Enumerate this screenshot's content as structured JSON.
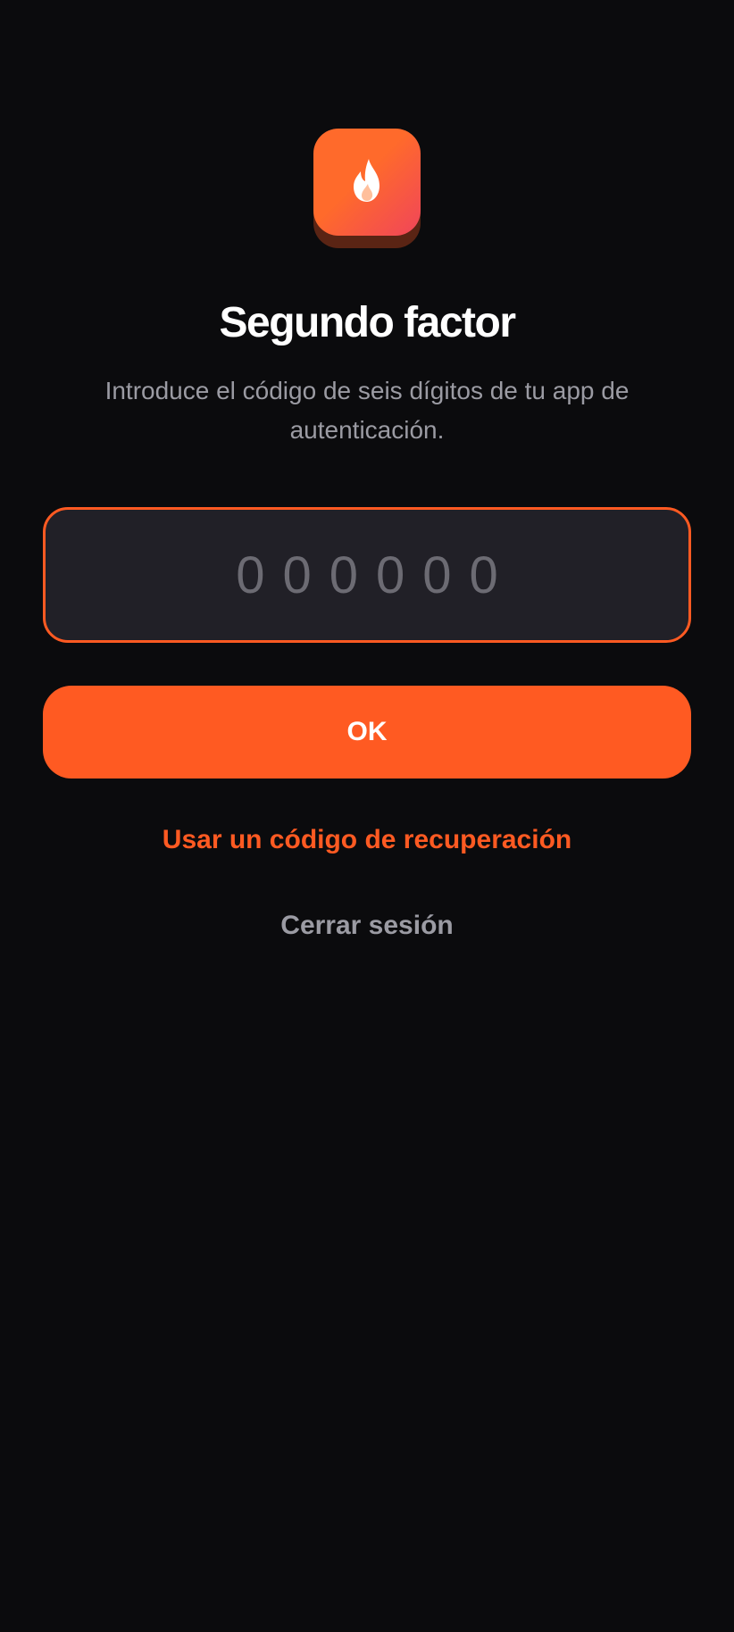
{
  "screen": {
    "title": "Segundo factor",
    "subtitle": "Introduce el código de seis dígitos de tu app de autenticación."
  },
  "app_icon": {
    "icon": "flame-icon",
    "gradient_start": "#ff6a2b",
    "gradient_end": "#f0455a"
  },
  "code_field": {
    "value": "",
    "placeholder": "000000",
    "border_color": "#ff5a22"
  },
  "actions": {
    "ok_label": "OK",
    "recovery_label": "Usar un código de recuperación",
    "logout_label": "Cerrar sesión"
  },
  "colors": {
    "background": "#0b0b0d",
    "accent": "#ff5a22",
    "muted_text": "#9b9ba3",
    "field_background": "#212027"
  }
}
